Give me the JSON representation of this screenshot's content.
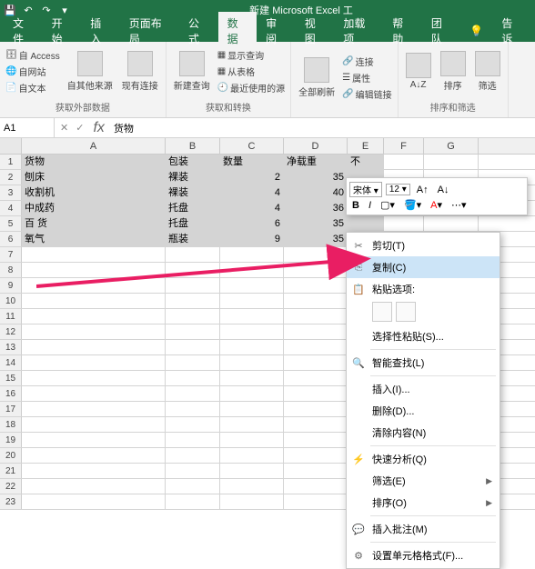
{
  "title": "新建 Microsoft Excel 工",
  "qat": {
    "save": "💾",
    "undo": "↶",
    "redo": "↷",
    "more": "▾"
  },
  "menu": [
    "文件",
    "开始",
    "插入",
    "页面布局",
    "公式",
    "数据",
    "审阅",
    "视图",
    "加载项",
    "帮助",
    "团队",
    "告诉"
  ],
  "menu_active": 5,
  "tell_me_icon": "💡",
  "ribbon": {
    "group1_label": "获取外部数据",
    "access": "自 Access",
    "web": "自网站",
    "text": "自文本",
    "other": "自其他来源",
    "existing": "现有连接",
    "group2_label": "获取和转换",
    "newquery": "新建查询",
    "show_query": "显示查询",
    "from_table": "从表格",
    "recent": "最近使用的源",
    "group3_label": "",
    "refresh": "全部刷新",
    "connections": "连接",
    "properties": "属性",
    "edit_links": "编辑链接",
    "sort_az": "A↓Z",
    "sort": "排序",
    "filter": "筛选",
    "group4_label": "排序和筛选"
  },
  "namebox": "A1",
  "formula": "货物",
  "cols": [
    "A",
    "B",
    "C",
    "D",
    "E",
    "F",
    "G"
  ],
  "rows": 23,
  "table": {
    "headers": [
      "货物",
      "包装",
      "数量",
      "净载重",
      "不"
    ],
    "data": [
      [
        "刨床",
        "裸装",
        "2",
        "35",
        ""
      ],
      [
        "收割机",
        "裸装",
        "4",
        "40",
        ""
      ],
      [
        "中成药",
        "托盘",
        "4",
        "36",
        ""
      ],
      [
        "百 货",
        "托盘",
        "6",
        "35",
        ""
      ],
      [
        "氧气",
        "瓶装",
        "9",
        "35",
        ""
      ]
    ]
  },
  "mini": {
    "font": "宋体",
    "size": "12",
    "bold": "B",
    "italic": "I"
  },
  "ctx": {
    "cut": "剪切(T)",
    "copy": "复制(C)",
    "paste_label": "粘贴选项:",
    "paste_special": "选择性粘贴(S)...",
    "smart_lookup": "智能查找(L)",
    "insert": "插入(I)...",
    "delete": "删除(D)...",
    "clear": "清除内容(N)",
    "quick": "快速分析(Q)",
    "filter": "筛选(E)",
    "sort": "排序(O)",
    "comment": "插入批注(M)",
    "format": "设置单元格格式(F)..."
  }
}
